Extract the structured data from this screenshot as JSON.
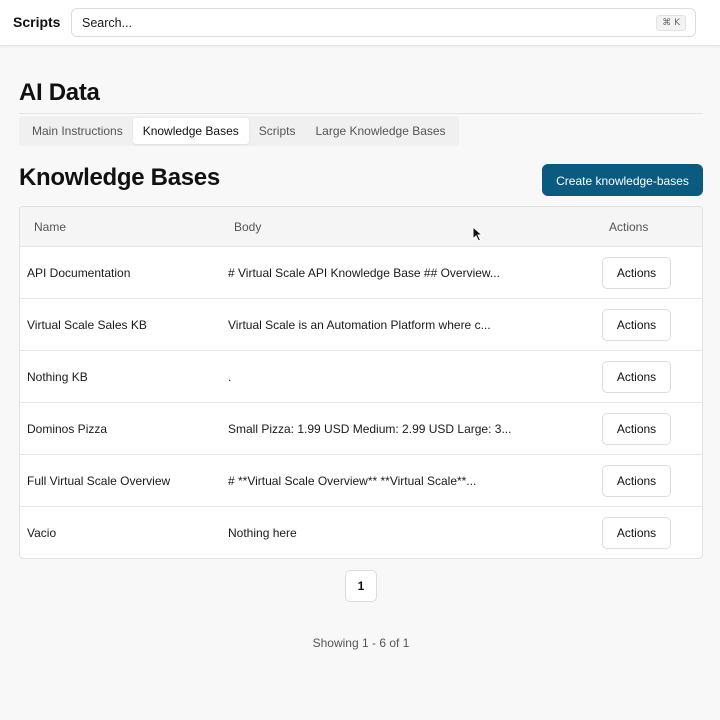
{
  "app": {
    "title": "Scripts"
  },
  "search": {
    "placeholder": "Search...",
    "shortcut": "⌘ K"
  },
  "page": {
    "title": "AI Data"
  },
  "tabs": [
    {
      "label": "Main Instructions",
      "active": false
    },
    {
      "label": "Knowledge Bases",
      "active": true
    },
    {
      "label": "Scripts",
      "active": false
    },
    {
      "label": "Large Knowledge Bases",
      "active": false
    }
  ],
  "section": {
    "title": "Knowledge Bases",
    "create_label": "Create knowledge-bases"
  },
  "table": {
    "columns": {
      "name": "Name",
      "body": "Body",
      "actions": "Actions"
    },
    "rows": [
      {
        "name": "API Documentation",
        "body": "# Virtual Scale API Knowledge Base ## Overview...",
        "action": "Actions"
      },
      {
        "name": "Virtual Scale Sales KB",
        "body": "Virtual Scale is an Automation Platform where c...",
        "action": "Actions"
      },
      {
        "name": "Nothing KB",
        "body": ".",
        "action": "Actions"
      },
      {
        "name": "Dominos Pizza",
        "body": "Small Pizza: 1.99 USD Medium: 2.99 USD Large: 3...",
        "action": "Actions"
      },
      {
        "name": "Full Virtual Scale Overview",
        "body": "# **Virtual Scale Overview** **Virtual Scale**...",
        "action": "Actions"
      },
      {
        "name": "Vacio",
        "body": "Nothing here",
        "action": "Actions"
      }
    ]
  },
  "pagination": {
    "current_page": "1",
    "showing": "Showing 1 - 6 of 1"
  },
  "colors": {
    "primary": "#0b5a80",
    "background": "#f8f8f8"
  }
}
